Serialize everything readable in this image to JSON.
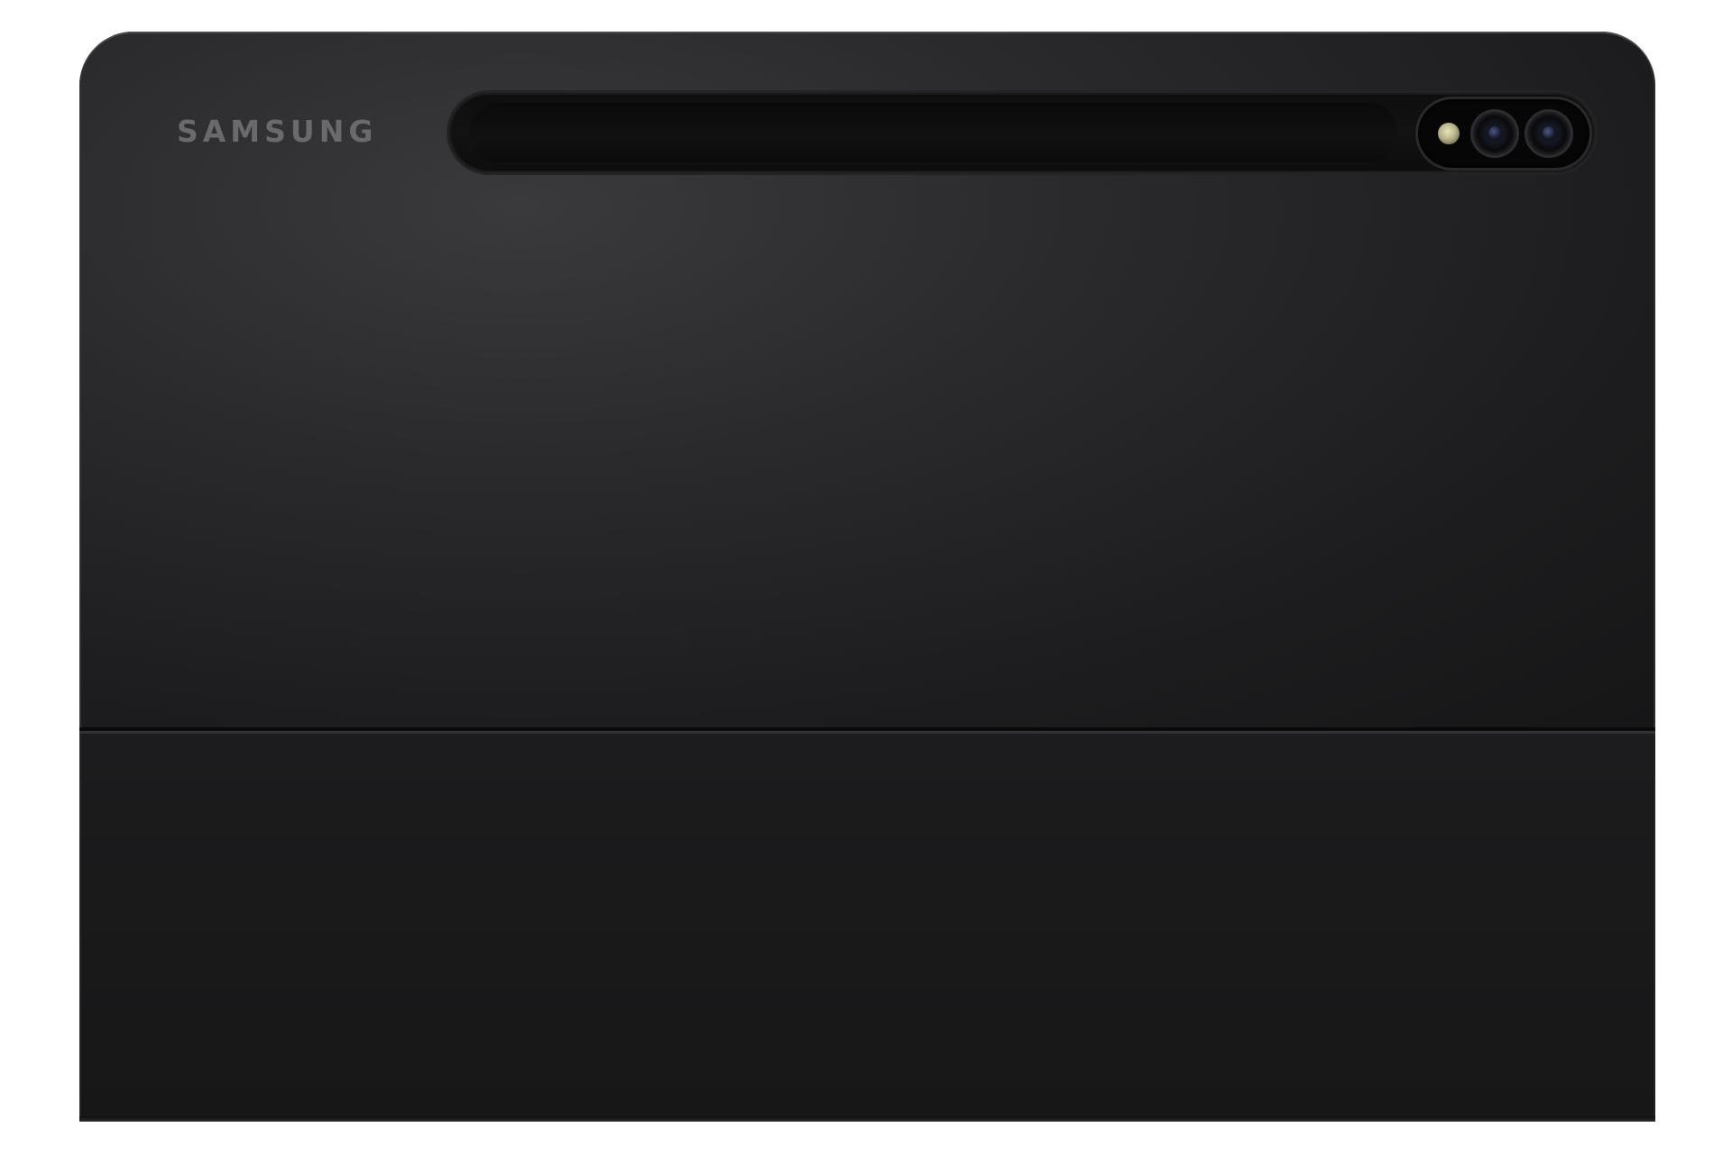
{
  "product": {
    "brand_logo": "SAMSUNG",
    "colors": {
      "body": "#1d1d1f",
      "logo": "#6a6a6d",
      "background": "#ffffff"
    }
  },
  "icons": [
    "flash-icon",
    "camera-lens-icon",
    "camera-lens-icon"
  ]
}
